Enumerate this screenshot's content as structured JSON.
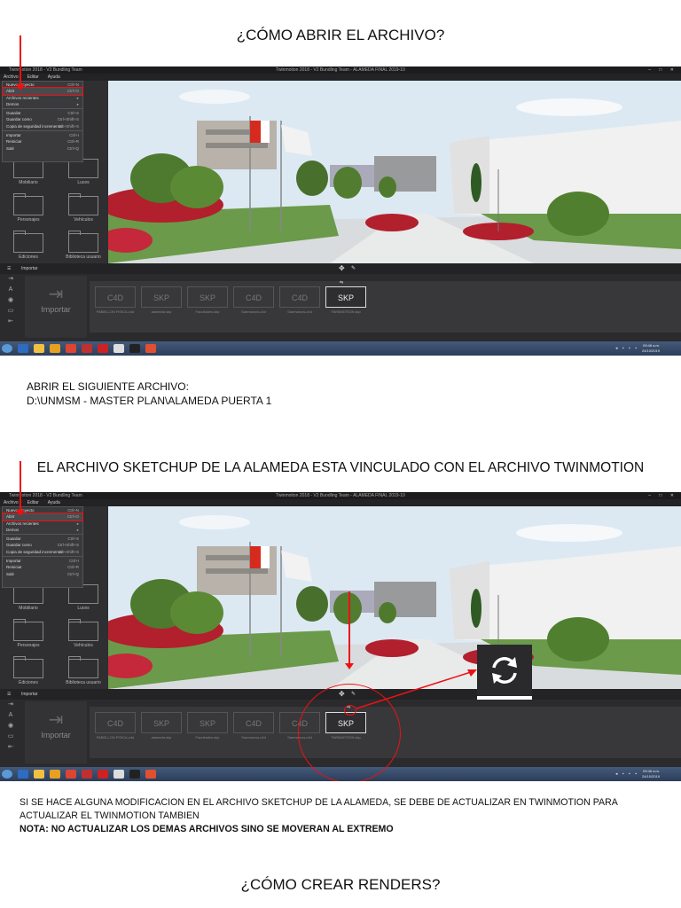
{
  "headings": {
    "h1": "¿CÓMO ABRIR EL ARCHIVO?",
    "h2": "EL ARCHIVO SKETCHUP DE LA ALAMEDA ESTA VINCULADO CON EL ARCHIVO TWINMOTION",
    "h3": "¿CÓMO CREAR RENDERS?"
  },
  "para1": {
    "line1": "ABRIR EL SIGUIENTE ARCHIVO:",
    "line2": "D:\\UNMSM - MASTER PLAN\\ALAMEDA PUERTA 1"
  },
  "para2": {
    "line1": "SI SE HACE ALGUNA MODIFICACION EN EL ARCHIVO SKETCHUP DE LA ALAMEDA, SE DEBE DE ACTUALIZAR EN TWINMOTION PARA",
    "line2": "ACTUALIZAR EL TWINMOTION TAMBIEN",
    "note": "NOTA: NO ACTUALIZAR LOS DEMAS ARCHIVOS SINO SE MOVERAN AL EXTREMO"
  },
  "app": {
    "app_name": "Twinmotion 2018 - V2 Bundling Team",
    "document": "Twinmotion 2018 - V2 Bundling Team - ALAMEDA FINAL 2019-10",
    "window_controls": "– □ ✕",
    "menu": [
      "Archivo",
      "Editar",
      "Ayuda"
    ],
    "dropdown": [
      {
        "label": "Nuevo proyecto",
        "shortcut": "Ctrl+N"
      },
      {
        "label": "Abrir",
        "shortcut": "Ctrl+O",
        "selected": true
      },
      {
        "label": "Archivos recientes",
        "shortcut": "▸"
      },
      {
        "label": "Demos",
        "shortcut": "▸"
      },
      {
        "label": "Guardar",
        "shortcut": "Ctrl+S"
      },
      {
        "label": "Guardar como",
        "shortcut": "Ctrl+Shift+S"
      },
      {
        "label": "Copia de seguridad incremental",
        "shortcut": "Alt+Shift+S"
      },
      {
        "label": "Importar",
        "shortcut": "Ctrl+I"
      },
      {
        "label": "Reiniciar",
        "shortcut": "Ctrl+R"
      },
      {
        "label": "Salir",
        "shortcut": "Ctrl+Q"
      }
    ],
    "library": [
      {
        "label": "Mobiliario"
      },
      {
        "label": "Luces"
      },
      {
        "label": "Personajes"
      },
      {
        "label": "Vehículos"
      },
      {
        "label": "Ediciones"
      },
      {
        "label": "Biblioteca usuario"
      }
    ],
    "panel_title": "Importar",
    "import_button": "Importar",
    "files": [
      {
        "type": "C4D",
        "name": "PABELLON FISICA.c4d"
      },
      {
        "type": "SKP",
        "name": "alameda.skp"
      },
      {
        "type": "SKP",
        "name": "Facultades.skp"
      },
      {
        "type": "C4D",
        "name": "Sanmarcos.c4d"
      },
      {
        "type": "C4D",
        "name": "Sanmarcos.c4d"
      },
      {
        "type": "SKP",
        "name": "TWINMOTION.skp",
        "active": true
      }
    ],
    "clock": "09:46 a.m.\n24/10/2019"
  },
  "colors": {
    "annotation_red": "#e11111",
    "ui_dark": "#2b2b2d"
  }
}
